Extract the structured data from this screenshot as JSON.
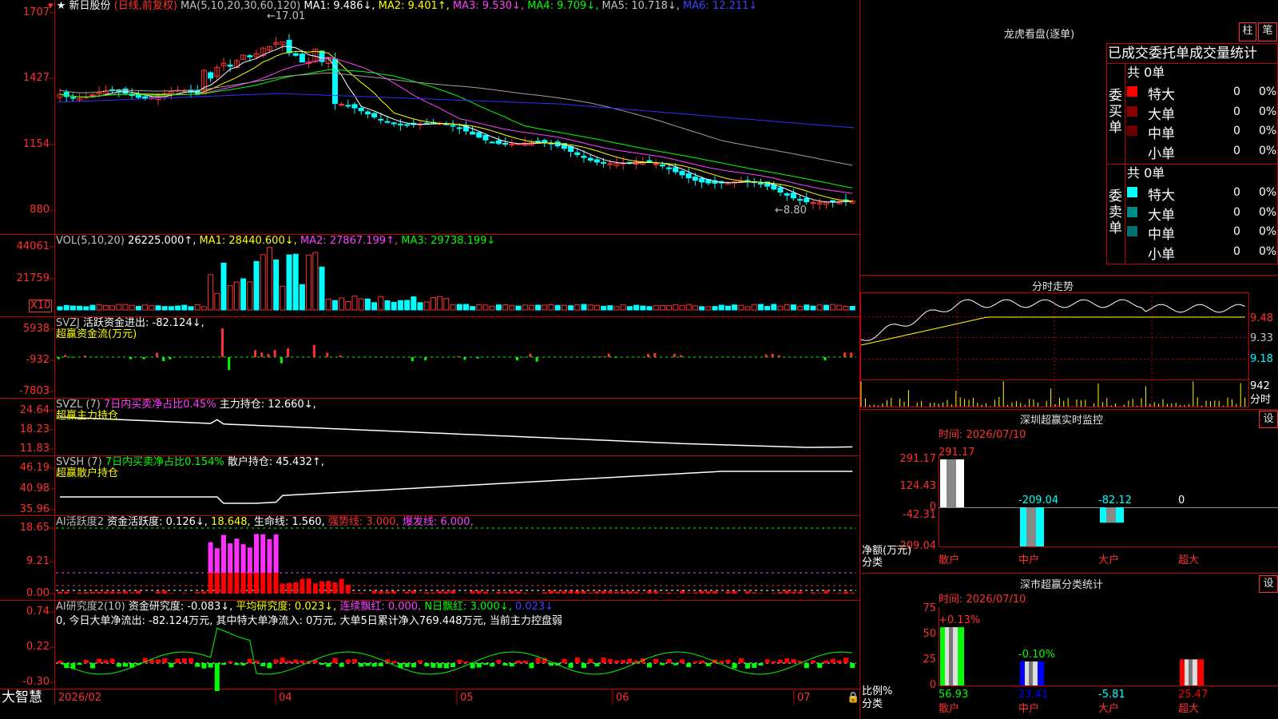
{
  "header": {
    "star": "★",
    "stock_name": "新日股份",
    "period_tag": "(日线,前复权)",
    "ma_spec": "MA(5,10,20,30,60,120)",
    "ma1": "MA1: 9.486↓,",
    "ma2": "MA2: 9.401↑,",
    "ma3": "MA3: 9.530↓,",
    "ma4": "MA4: 9.709↓,",
    "ma5": "MA5: 10.718↓,",
    "ma6": "MA6: 12.211↓"
  },
  "price_axis": [
    "1707",
    "1427",
    "1154",
    "880"
  ],
  "price_annotations": {
    "high": "←17.01",
    "low": "←8.80"
  },
  "vol": {
    "label": "VOL(5,10,20)",
    "value": "26225.000↑,",
    "ma1": "MA1: 28440.600↓,",
    "ma2": "MA2: 27867.199↑,",
    "ma3": "MA3: 29738.199↓",
    "axis": [
      "44061",
      "21759"
    ],
    "unit": "X10"
  },
  "svzj": {
    "label": "SVZJ",
    "text": "活跃资金进出: -82.124↓,",
    "sub": "超赢资金流(万元)",
    "axis": [
      "5938",
      "-932",
      "-7803"
    ]
  },
  "svzl": {
    "label": "SVZL (7)",
    "ratio": "7日内买卖净占比0.45%",
    "text": "主力持仓: 12.660↓,",
    "sub": "超赢主力持仓",
    "axis": [
      "24.64",
      "18.23",
      "11.83"
    ]
  },
  "svsh": {
    "label": "SVSH (7)",
    "ratio": "7日内买卖净占比0.154%",
    "text": "散户持仓: 45.432↑,",
    "sub": "超赢散户持仓",
    "axis": [
      "46.19",
      "40.98",
      "35.96"
    ]
  },
  "ai1": {
    "label": "AI活跃度2",
    "t1": "资金活跃度: 0.126↓,",
    "t2": "18.648,",
    "t3": "生命线: 1.560,",
    "t4": "强势线: 3.000,",
    "t5": "爆发线: 6.000,",
    "axis": [
      "18.65",
      "9.21",
      "0.00"
    ]
  },
  "ai2": {
    "label": "AI研究度2(10)",
    "t1": "资金研究度: -0.083↓,",
    "t2": "平均研究度: 0.023↓,",
    "t3": "连续飘红: 0.000,",
    "t4": "N日飘红: 3.000↓,",
    "t5": "0.023↓",
    "line2": "0, 今日大单净流出: -82.124万元, 其中特大单净流入: 0万元, 大单5日累计净入769.448万元, 当前主力控盘弱",
    "axis": [
      "0.74",
      "0.22",
      "-0.30"
    ]
  },
  "xaxis": [
    "2026/02",
    "04",
    "05",
    "06",
    "07"
  ],
  "brand": "大智慧",
  "dragon": {
    "title": "龙虎看盘(逐单)",
    "btn1": "柱",
    "btn2": "笔",
    "heading": "已成交委托单成交量统计",
    "buy_label": "委买单",
    "sell_label": "委卖单",
    "buy_total": "共 0单",
    "sell_total": "共 0单",
    "buy_rows": [
      {
        "name": "特大",
        "qty": "0",
        "pct": "0%",
        "color": "#ff0000"
      },
      {
        "name": "大单",
        "qty": "0",
        "pct": "0%",
        "color": "#8b0000"
      },
      {
        "name": "中单",
        "qty": "0",
        "pct": "0%",
        "color": "#700000"
      },
      {
        "name": "小单",
        "qty": "0",
        "pct": "0%",
        "color": ""
      }
    ],
    "sell_rows": [
      {
        "name": "特大",
        "qty": "0",
        "pct": "0%",
        "color": "#00ffff"
      },
      {
        "name": "大单",
        "qty": "0",
        "pct": "0%",
        "color": "#008b8b"
      },
      {
        "name": "中单",
        "qty": "0",
        "pct": "0%",
        "color": "#007070"
      },
      {
        "name": "小单",
        "qty": "0",
        "pct": "0%",
        "color": ""
      }
    ]
  },
  "intraday": {
    "title": "分时走势",
    "axis": [
      "9.48",
      "9.33",
      "9.18"
    ],
    "vol_value": "942",
    "vol_unit": "分时"
  },
  "sz_monitor": {
    "title": "深圳超赢实时监控",
    "btn": "设",
    "time": "时间: 2026/07/10",
    "axis": [
      "291.17",
      "124.43",
      "0",
      "-42.31",
      "-209.04"
    ],
    "ylabel1": "净额(万元)",
    "ylabel2": "分类",
    "bars": [
      {
        "cat": "散户",
        "value": 291.17,
        "label": "291.17"
      },
      {
        "cat": "中户",
        "value": -209.04,
        "label": "-209.04"
      },
      {
        "cat": "大户",
        "value": -82.12,
        "label": "-82.12"
      },
      {
        "cat": "超大",
        "value": 0,
        "label": "0"
      }
    ]
  },
  "sz_class": {
    "title": "深市超赢分类统计",
    "btn": "设",
    "time": "时间: 2026/07/10",
    "axis": [
      "75",
      "50",
      "25",
      "0"
    ],
    "ylabel1": "比例%",
    "ylabel2": "分类",
    "bars": [
      {
        "cat": "散户",
        "value": 56.93,
        "label": "56.93",
        "delta": "+0.13%"
      },
      {
        "cat": "中户",
        "value": 23.41,
        "label": "23.41",
        "delta": "-0.10%"
      },
      {
        "cat": "大户",
        "value": -5.81,
        "label": "-5.81",
        "delta": ""
      },
      {
        "cat": "超大",
        "value": 25.47,
        "label": "25.47",
        "delta": ""
      }
    ]
  },
  "chart_data": [
    {
      "type": "bar",
      "title": "深圳超赢实时监控",
      "categories": [
        "散户",
        "中户",
        "大户",
        "超大"
      ],
      "values": [
        291.17,
        -209.04,
        -82.12,
        0
      ],
      "ylabel": "净额(万元)",
      "ylim": [
        -209.04,
        291.17
      ]
    },
    {
      "type": "bar",
      "title": "深市超赢分类统计",
      "categories": [
        "散户",
        "中户",
        "大户",
        "超大"
      ],
      "values": [
        56.93,
        23.41,
        -5.81,
        25.47
      ],
      "ylabel": "比例%",
      "ylim": [
        0,
        75
      ]
    }
  ],
  "colors": {
    "up": "#ff3030",
    "down": "#00ffff",
    "grid": "#ff0000"
  }
}
